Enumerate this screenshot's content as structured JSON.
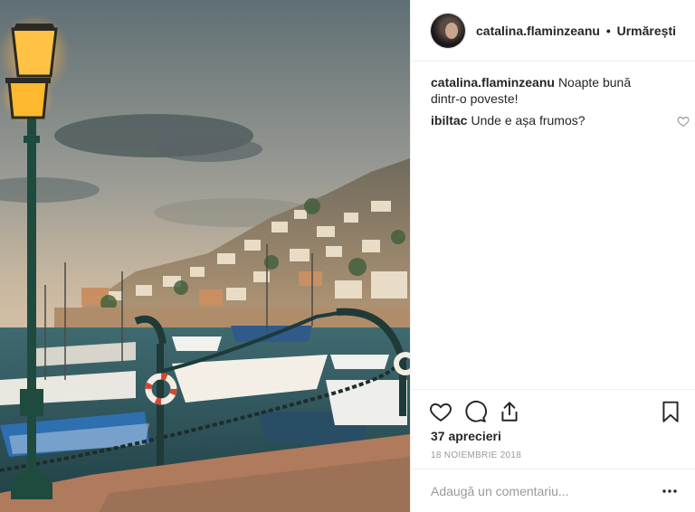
{
  "post": {
    "username": "catalina.flaminzeanu",
    "separator": "•",
    "follow_label": "Urmărești"
  },
  "comments": [
    {
      "user": "catalina.flaminzeanu",
      "text": "Noapte bună dintr-o poveste!"
    },
    {
      "user": "ibiltac",
      "text": "Unde e așa frumos?"
    }
  ],
  "stats": {
    "likes": "37 aprecieri",
    "date": "18 NOIEMBRIE 2018"
  },
  "add_comment": {
    "placeholder": "Adaugă un comentariu..."
  },
  "icons": {
    "like": "heart-icon",
    "comment": "comment-bubble-icon",
    "share": "share-icon",
    "save": "bookmark-icon",
    "more": "more-dots-icon",
    "comment_like": "heart-icon"
  },
  "colors": {
    "text": "#262626",
    "muted": "#999999",
    "border": "#efefef"
  }
}
